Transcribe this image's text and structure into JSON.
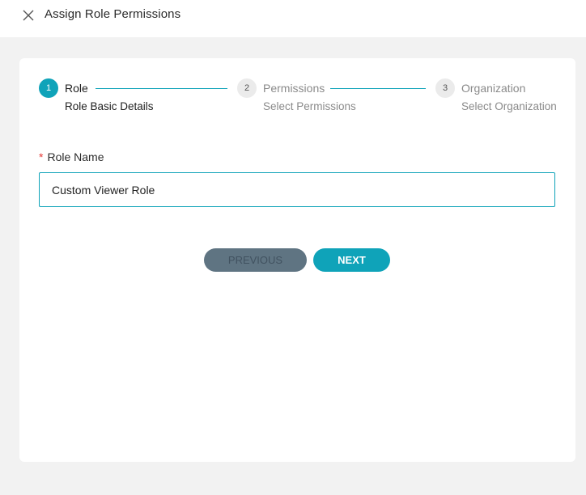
{
  "dialog": {
    "title": "Assign Role Permissions",
    "close_icon": "close-icon"
  },
  "stepper": {
    "accent_color": "#0fa3b9",
    "steps": [
      {
        "number": "1",
        "title": "Role",
        "subtitle": "Role Basic Details",
        "state": "active"
      },
      {
        "number": "2",
        "title": "Permissions",
        "subtitle": "Select Permissions",
        "state": "inactive"
      },
      {
        "number": "3",
        "title": "Organization",
        "subtitle": "Select Organization",
        "state": "inactive"
      }
    ]
  },
  "form": {
    "role_name": {
      "required_mark": "*",
      "label": "Role Name",
      "value": "Custom Viewer Role"
    }
  },
  "actions": {
    "previous_label": "PREVIOUS",
    "next_label": "NEXT"
  }
}
